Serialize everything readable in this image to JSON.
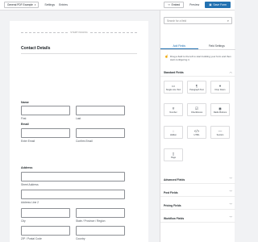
{
  "topbar": {
    "form_select": "General PDF Example",
    "settings": "Settings",
    "entries": "Entries",
    "embed": "Embed",
    "preview": "Preview",
    "save": "Save Form"
  },
  "canvas": {
    "page_marker": "START PAGING",
    "section_title": "Contact Details",
    "name_label": "Name",
    "first": "First",
    "last": "Last",
    "email_label": "Email",
    "enter_email": "Enter Email",
    "confirm_email": "Confirm Email",
    "address_label": "Address",
    "street": "Street Address",
    "line2": "Address Line 2",
    "city": "City",
    "state": "State / Province / Region",
    "zip": "ZIP / Postal Code",
    "country": "Country"
  },
  "panel": {
    "search_placeholder": "Search for a field",
    "tab_add": "Add Fields",
    "tab_settings": "Field Settings",
    "hint": "Drag a field to the left to start building your form and then start configuring it.",
    "standard": "Standard Fields",
    "advanced": "Advanced Fields",
    "post": "Post Fields",
    "pricing": "Pricing Fields",
    "workflow": "Workflow Fields",
    "tiles": [
      {
        "label": "Single Line Text",
        "icon": "text-icon"
      },
      {
        "label": "Paragraph Text",
        "icon": "paragraph-icon"
      },
      {
        "label": "Drop Down",
        "icon": "dropdown-icon"
      },
      {
        "label": "Number",
        "icon": "number-icon"
      },
      {
        "label": "Checkboxes",
        "icon": "checkbox-icon"
      },
      {
        "label": "Radio Buttons",
        "icon": "radio-icon"
      },
      {
        "label": "Hidden",
        "icon": "hidden-icon"
      },
      {
        "label": "HTML",
        "icon": "html-icon"
      },
      {
        "label": "Section",
        "icon": "section-icon"
      },
      {
        "label": "Page",
        "icon": "page-icon"
      }
    ]
  }
}
